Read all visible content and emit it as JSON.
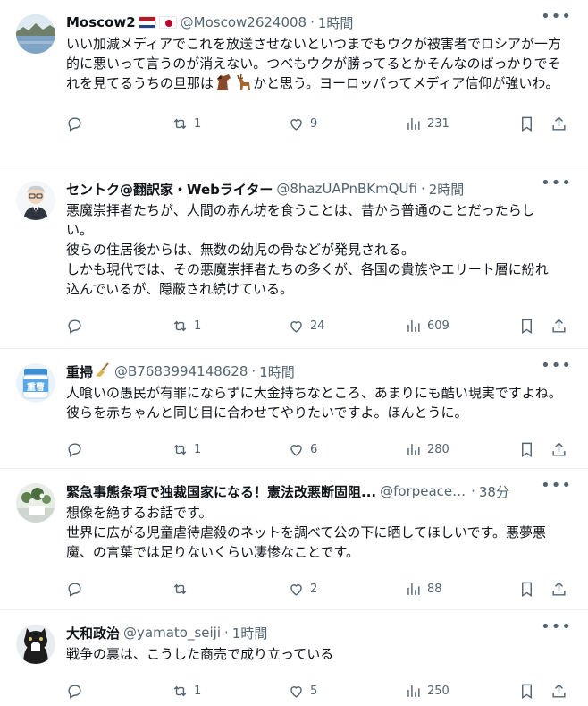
{
  "tweets": [
    {
      "name": "Moscow2",
      "handle": "@Moscow2624008",
      "sep": "·",
      "time": "1時間",
      "text": "いい加減メディアでこれを放送させないといつまでもウクが被害者でロシアが一方的に悪いって言うのが消えない。つべもウクが勝ってるとかそんなのばっかりでそれを見てるうちの旦那は",
      "text_after": "かと思う。ヨーロッパってメディア信仰が強いわ。",
      "retweets": "1",
      "likes": "9",
      "views": "231",
      "avatar_icon": "lake-photo-avatar",
      "flags": [
        "netherlands-flag",
        "japan-flag"
      ],
      "inline_emoji": [
        "horse-icon",
        "deer-icon"
      ]
    },
    {
      "name": "セントク@翻訳家・Webライター",
      "handle": "@8hazUAPnBKmQUfi",
      "sep": "·",
      "time": "2時間",
      "text": "悪魔崇拝者たちが、人間の赤ん坊を食うことは、昔から普通のことだったらしい。\n彼らの住居後からは、無数の幼児の骨などが発見される。\nしかも現代では、その悪魔崇拝者たちの多くが、各国の貴族やエリート層に紛れ込んでいるが、隠蔽され続けている。",
      "retweets": "1",
      "likes": "24",
      "views": "609",
      "avatar_icon": "illustrated-man-avatar"
    },
    {
      "name": "重掃",
      "handle": "@B7683994148628",
      "sep": "·",
      "time": "1時間",
      "text": "人喰いの愚民が有罪にならずに大金持ちなところ、あまりにも酷い現実ですよね。　彼らを赤ちゃんと同じ目に合わせてやりたいですよ。ほんとうに。",
      "retweets": "1",
      "likes": "6",
      "views": "280",
      "avatar_icon": "jar-label-avatar",
      "avatar_label": "重曹",
      "name_emoji": "broom-icon"
    },
    {
      "name": "緊急事態条項で独裁国家になる！憲法改悪断固阻...",
      "handle": "@forpeacee...",
      "sep": "·",
      "time": "38分",
      "text": "想像を絶するお話です。\n世界に広がる児童虐待虐殺のネットを調べて公の下に晒してほしいです。悪夢悪魔、の言葉では足りないくらい凄惨なことです。",
      "retweets": "",
      "likes": "2",
      "views": "88",
      "avatar_icon": "flowers-photo-avatar"
    },
    {
      "name": "大和政治",
      "handle": "@yamato_seiji",
      "sep": "·",
      "time": "1時間",
      "text": "戦争の裏は、こうした商売で成り立っている",
      "retweets": "1",
      "likes": "5",
      "views": "250",
      "avatar_icon": "cat-photo-avatar"
    }
  ]
}
